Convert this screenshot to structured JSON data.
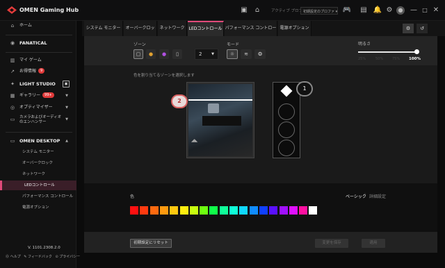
{
  "app": {
    "title": "OMEN Gaming Hub"
  },
  "titlebar": {
    "profile_label": "アクティブ プロファイル",
    "profile_value": "初期設定のプロファ",
    "icons": [
      "gamepad-icon",
      "home-icon",
      "photo-icon",
      "badge-icon",
      "bell-icon",
      "gear-icon",
      "account-icon"
    ],
    "window_controls": [
      "minimize-icon",
      "maximize-icon",
      "close-icon"
    ]
  },
  "sidebar": {
    "home": "ホーム",
    "fanatical": "FANATICAL",
    "my_games": "マイ ゲーム",
    "deals": "お得情報",
    "deals_badge": "9",
    "light_studio": "LIGHT STUDIO",
    "gallery": "ギャラリー",
    "gallery_badge": "99+",
    "optimizer": "オプティマイザー",
    "camera_audio": "カメラおよびオーディオのエンハンサー",
    "omen_desktop": "OMEN DESKTOP",
    "sub_items": [
      "システム モニター",
      "オーバークロック",
      "ネットワーク",
      "LEDコントロール",
      "パフォーマンス コントロール",
      "電源オプション"
    ],
    "active_sub": "LEDコントロール",
    "version": "V. 1101.2308.2.0",
    "footer": [
      "ヘルプ",
      "フィードバック",
      "プライバシー"
    ]
  },
  "tabs": [
    "システム モニター",
    "オーバークロック",
    "ネットワーク",
    "LEDコントロール",
    "パフォーマンス コントロール",
    "電源オプション"
  ],
  "active_tab": "LEDコントロール",
  "zone": {
    "label": "ゾーン",
    "count_value": "2",
    "mode_label": "モード"
  },
  "brightness": {
    "label": "明るさ",
    "levels": [
      "25%",
      "50%",
      "75%",
      "100%"
    ],
    "value": "100%"
  },
  "preview": {
    "instruction": "色を割り当てるゾーンを選択します",
    "zone_callout_2": "2",
    "zone_callout_1": "1"
  },
  "color": {
    "label": "色",
    "mode_basic": "ベーシック",
    "mode_separator": "|",
    "mode_advanced": "詳細設定",
    "swatches": [
      "#ff1010",
      "#ff3a10",
      "#ff6a10",
      "#ff9a10",
      "#ffc810",
      "#ffee10",
      "#c8ff10",
      "#6eff10",
      "#10ff4a",
      "#10ff9a",
      "#10ffd8",
      "#10d8ff",
      "#108cff",
      "#1040ff",
      "#5a10ff",
      "#a010ff",
      "#e010ff",
      "#ff10a0",
      "#ffffff"
    ]
  },
  "footer_buttons": {
    "reset": "初期設定にリセット",
    "save_profile": "変更を保存",
    "apply": "適用"
  }
}
